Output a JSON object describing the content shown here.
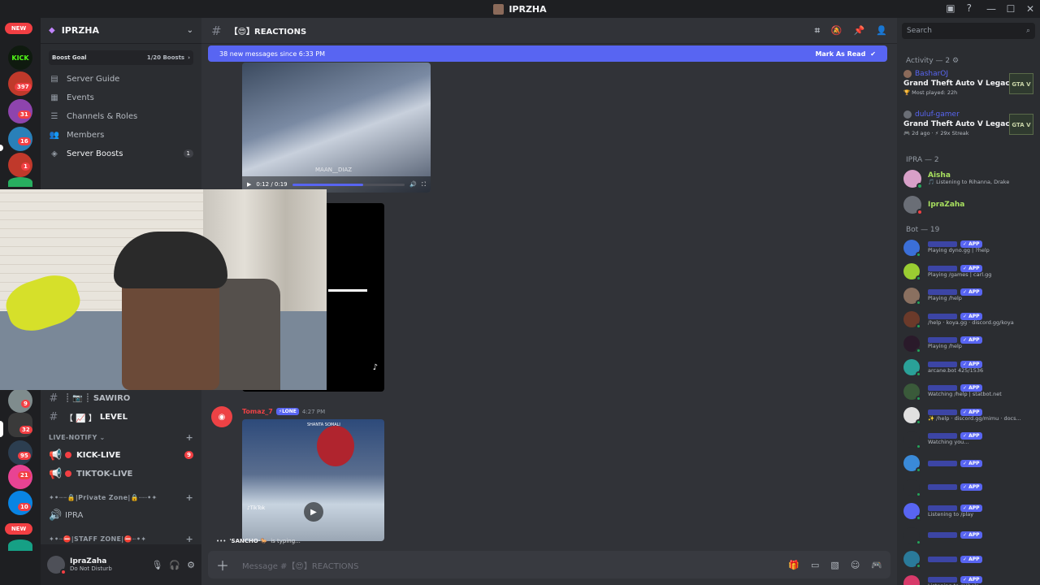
{
  "window": {
    "title": "IPRZHA",
    "controls": [
      "—",
      "☐",
      "✕"
    ]
  },
  "rail": {
    "new_top": "NEW",
    "new_bottom": "NEW",
    "badges": [
      "397",
      "31",
      "16",
      "1",
      "9",
      "32",
      "95",
      "21",
      "10"
    ],
    "kick_label": "KICK"
  },
  "sidebar": {
    "server_name": "IPRZHA",
    "boost_goal": "Boost Goal",
    "boost_count": "1/20 Boosts",
    "nav": [
      {
        "label": "Server Guide"
      },
      {
        "label": "Events"
      },
      {
        "label": "Channels & Roles"
      },
      {
        "label": "Members"
      },
      {
        "label": "Server Boosts",
        "count": "1"
      }
    ],
    "channels_top": [
      {
        "label": "SAWIRO",
        "prefix": "┊ 📷 ┊"
      },
      {
        "label": "LEVEL",
        "prefix": "【 📈 】"
      }
    ],
    "live_category": "LIVE-NOTIFY",
    "live_channels": [
      {
        "label": "KICK-LIVE",
        "badge": "9"
      },
      {
        "label": "TIKTOK-LIVE"
      }
    ],
    "private_category": "✦•┈┈🔒|Private Zone|🔒┈┈•✦",
    "private_channel": "IPRA",
    "staff_category": "✦•┈⛔|STAFF ZONE|⛔┈•✦"
  },
  "user": {
    "name": "IpraZaha",
    "status": "Do Not Disturb"
  },
  "channel": {
    "name": "【😍】REACTIONS",
    "new_messages": "38 new messages since 6:33 PM",
    "mark_read": "Mark As Read",
    "video1_watermark": "MAAN__DIAZ",
    "video1_time": "0:12 / 0:19",
    "video1_progress": 0.63,
    "message_author": "Tomaz_7",
    "message_tag": "⚡LONE",
    "message_time": "4:27 PM",
    "video3_top": "SHANTA SOMALI",
    "video3_label": "♪TikTok",
    "typing_user": "'SANCHO·🐎",
    "typing_text": "is typing...",
    "composer_placeholder": "Message #【😍】REACTIONS"
  },
  "members": {
    "search_placeholder": "Search",
    "activity_header": "Activity — 2",
    "activities": [
      {
        "user": "BasharOJ",
        "game": "Grand Theft Auto V Legacy",
        "detail": "🏆 Most played: 22h"
      },
      {
        "user": "duluf-gamer",
        "game": "Grand Theft Auto V Legacy",
        "detail": "🎮 2d ago · ⚡ 29x Streak"
      }
    ],
    "gta_label": "GTA V",
    "ipra_header": "IPRA — 2",
    "ipra_members": [
      {
        "name": "Aisha",
        "status": "🎵 Listening to Rihanna, Drake",
        "color": "#a8e05f",
        "avatar": "#d8a0c8"
      },
      {
        "name": "IpraZaha",
        "status": "",
        "color": "#a8e05f",
        "avatar": "#6a6e76"
      }
    ],
    "bot_header": "Bot — 19",
    "app_tag": "✓ APP",
    "bots": [
      {
        "status": "Playing dyno.gg | ?help",
        "avatar": "#3b6fd8"
      },
      {
        "status": "Playing /games | carl.gg",
        "avatar": "#9acd32"
      },
      {
        "status": "Playing /help",
        "avatar": "#8a7060"
      },
      {
        "status": "/help · koya.gg · discord.gg/koya",
        "avatar": "#6b3a2a"
      },
      {
        "status": "Playing /help",
        "avatar": "#2a1a2a"
      },
      {
        "status": "arcane.bot 425/1536",
        "avatar": "#2aa198"
      },
      {
        "status": "Watching /help | statbot.net",
        "avatar": "#3a5a3a"
      },
      {
        "status": "✨ /help · discord.gg/mimu · docs...",
        "avatar": "#e0e0e0"
      },
      {
        "status": "Watching you...",
        "avatar": "#2b2d31"
      },
      {
        "status": "",
        "avatar": "#3a8ad8"
      },
      {
        "status": "",
        "avatar": "#2b2d31"
      },
      {
        "status": "Listening to /play",
        "avatar": "#5865f2"
      },
      {
        "status": "",
        "avatar": "#2b2d31"
      },
      {
        "status": "",
        "avatar": "#2a7a9a"
      },
      {
        "status": "Listening to m!help",
        "avatar": "#d83a6a"
      }
    ]
  }
}
